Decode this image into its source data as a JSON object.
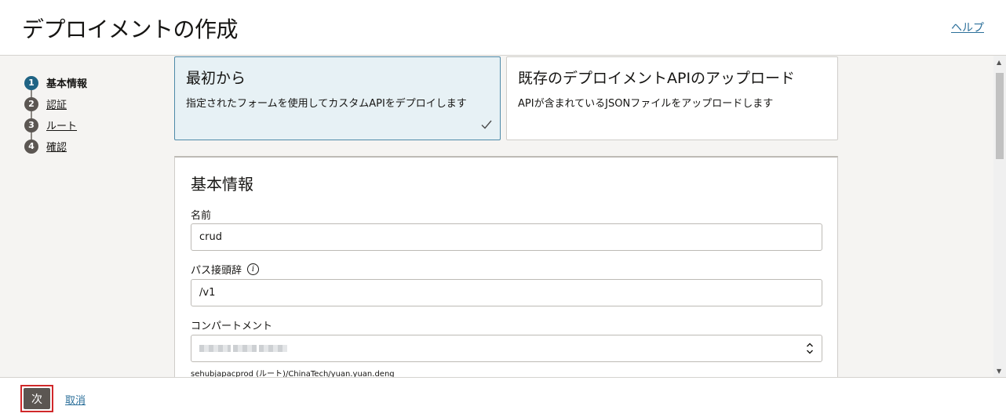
{
  "header": {
    "title": "デプロイメントの作成",
    "help_label": "ヘルプ"
  },
  "steps": [
    {
      "num": "1",
      "label": "基本情報",
      "active": true
    },
    {
      "num": "2",
      "label": "認証",
      "active": false
    },
    {
      "num": "3",
      "label": "ルート",
      "active": false
    },
    {
      "num": "4",
      "label": "確認",
      "active": false
    }
  ],
  "options": [
    {
      "title": "最初から",
      "desc": "指定されたフォームを使用してカスタムAPIをデプロイします",
      "selected": true
    },
    {
      "title": "既存のデプロイメントAPIのアップロード",
      "desc": "APIが含まれているJSONファイルをアップロードします",
      "selected": false
    }
  ],
  "form": {
    "title": "基本情報",
    "name_label": "名前",
    "name_value": "crud",
    "prefix_label": "パス接頭辞",
    "prefix_value": "/v1",
    "compartment_label": "コンパートメント",
    "compartment_path": "sehubjapacprod (ルート)/ChinaTech/yuan.yuan.deng"
  },
  "footer": {
    "next_label": "次",
    "cancel_label": "取消"
  },
  "colors": {
    "accent": "#1f6384",
    "link": "#2b6f9a",
    "selected_bg": "#e7f1f5",
    "highlight": "#d0282a"
  },
  "icons": [
    "check-icon",
    "info-icon",
    "select-arrows-icon"
  ]
}
